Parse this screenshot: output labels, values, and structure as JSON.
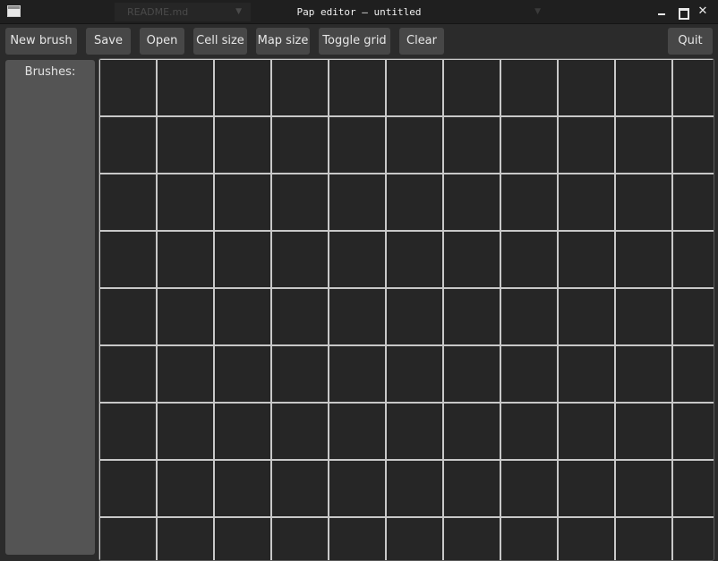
{
  "window": {
    "title": "Pap editor – untitled",
    "close_glyph": "✕"
  },
  "background_tabs": [
    {
      "label": ""
    },
    {
      "label": "README.md",
      "caret": "▼"
    },
    {
      "label": "",
      "caret": "▼"
    },
    {
      "label": ""
    }
  ],
  "toolbar": {
    "new_brush": "New brush",
    "save": "Save",
    "open": "Open",
    "cell_size": "Cell size",
    "map_size": "Map size",
    "toggle_grid": "Toggle grid",
    "clear": "Clear",
    "quit": "Quit"
  },
  "sidebar": {
    "label": "Brushes:"
  },
  "canvas": {
    "grid_visible": true,
    "background_color": "#262626",
    "grid_color": "#c8c8c8"
  },
  "icons": {
    "app": "window-app-icon",
    "minimize": "minimize-icon",
    "maximize": "maximize-icon",
    "close": "close-icon"
  }
}
